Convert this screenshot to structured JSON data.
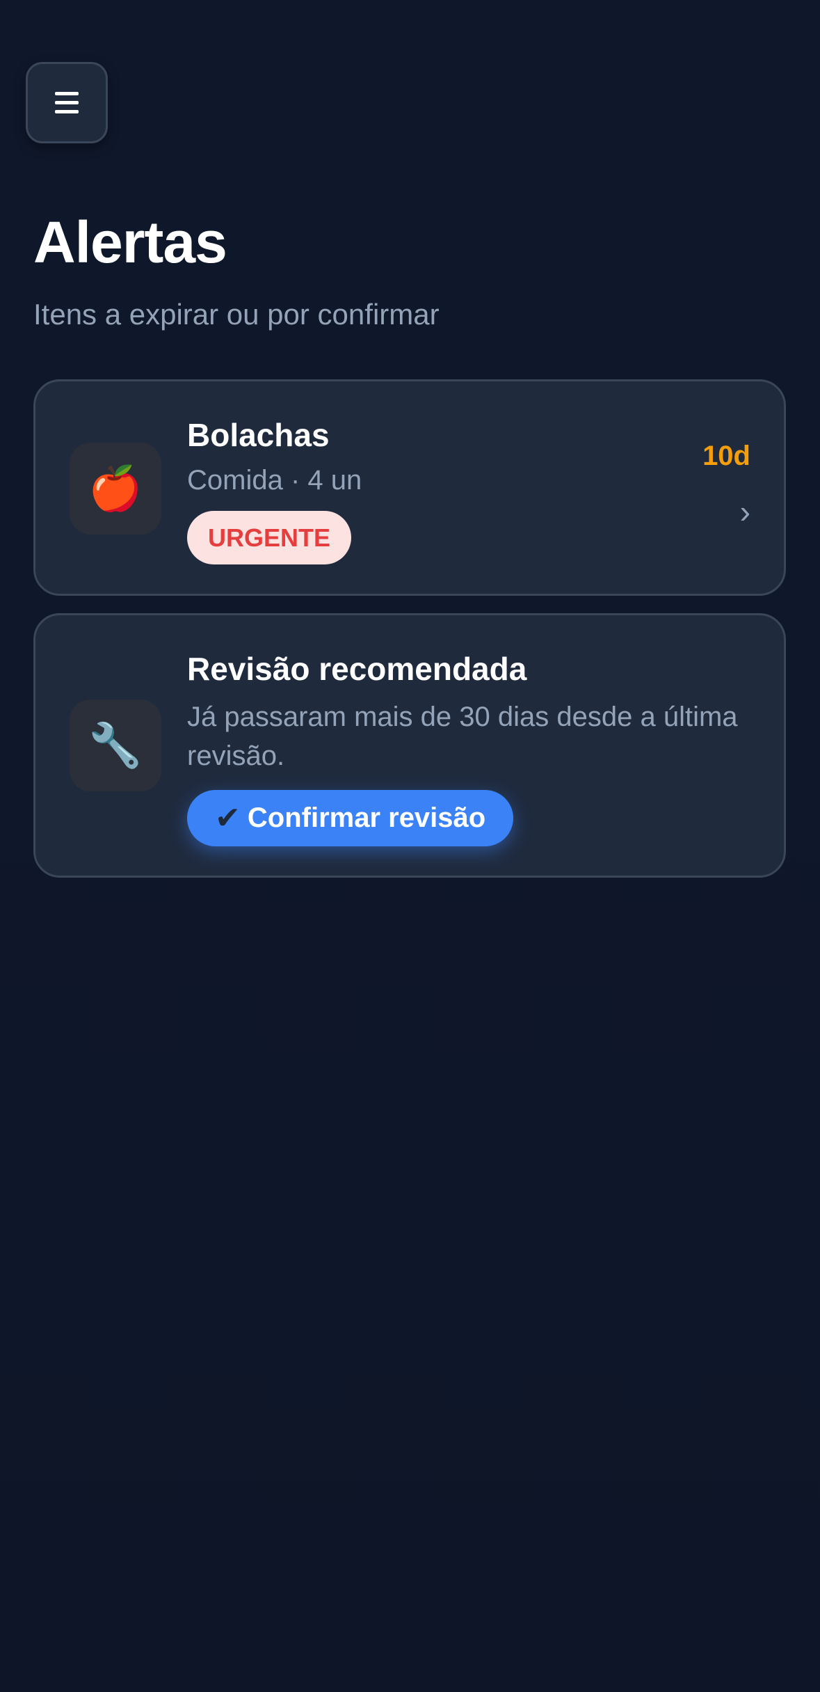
{
  "header": {
    "menu_icon": "hamburger-menu-icon"
  },
  "page": {
    "title": "Alertas",
    "subtitle": "Itens a expirar ou por confirmar"
  },
  "alerts": [
    {
      "icon": "🍎",
      "icon_name": "apple-icon",
      "title": "Bolachas",
      "meta": "Comida · 4 un",
      "badge": "URGENTE",
      "days": "10d",
      "chevron": "›"
    },
    {
      "icon": "🔧",
      "icon_name": "wrench-icon",
      "title": "Revisão recomendada",
      "description": "Já passaram mais de 30 dias desde a última revisão.",
      "button_check": "✔",
      "button_label": "Confirmar revisão"
    }
  ],
  "colors": {
    "background": "#0f172a",
    "card": "#1f2a3d",
    "accent": "#3b82f6",
    "warning": "#f59e0b",
    "urgent": "#e53e3e"
  }
}
